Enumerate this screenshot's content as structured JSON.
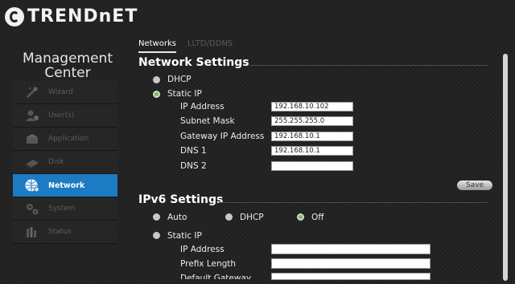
{
  "brand": {
    "name": "TRENDnET"
  },
  "sidebar": {
    "title_line1": "Management",
    "title_line2": "Center",
    "items": [
      {
        "label": "Wizard",
        "icon": "wand-icon"
      },
      {
        "label": "User(s)",
        "icon": "users-icon"
      },
      {
        "label": "Application",
        "icon": "application-icon"
      },
      {
        "label": "Disk",
        "icon": "disk-icon"
      },
      {
        "label": "Network",
        "icon": "network-globe-icon",
        "active": true
      },
      {
        "label": "System",
        "icon": "gears-icon"
      },
      {
        "label": "Status",
        "icon": "status-bars-icon"
      }
    ]
  },
  "tabs": [
    {
      "label": "Networks",
      "active": true
    },
    {
      "label": "LLTD/DDNS",
      "active": false
    }
  ],
  "network": {
    "title": "Network Settings",
    "dhcp_label": "DHCP",
    "static_label": "Static IP",
    "selected": "Static IP",
    "fields": [
      {
        "label": "IP Address",
        "value": "192.168.10.102"
      },
      {
        "label": "Subnet Mask",
        "value": "255.255.255.0"
      },
      {
        "label": "Gateway IP Address",
        "value": "192.168.10.1"
      },
      {
        "label": "DNS 1",
        "value": "192.168.10.1"
      },
      {
        "label": "DNS 2",
        "value": ""
      }
    ],
    "save_label": "Save"
  },
  "ipv6": {
    "title": "IPv6 Settings",
    "options": [
      "Auto",
      "DHCP",
      "Off"
    ],
    "selected": "Off",
    "static_label": "Static IP",
    "fields": [
      {
        "label": "IP Address",
        "value": ""
      },
      {
        "label": "Prefix Length",
        "value": ""
      },
      {
        "label": "Default Gateway",
        "value": ""
      }
    ]
  },
  "colors": {
    "accent": "#1d7bc4",
    "radio_on": "#7fbf3c",
    "background": "#232323"
  }
}
